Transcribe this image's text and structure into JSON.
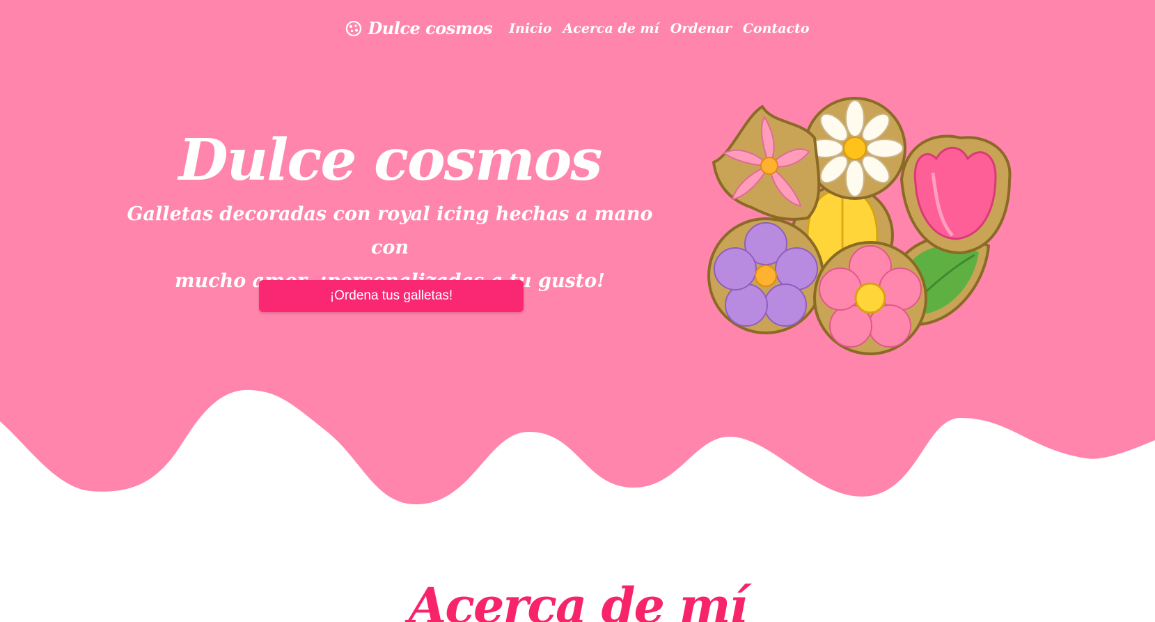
{
  "nav": {
    "brand": "Dulce cosmos",
    "links": [
      "Inicio",
      "Acerca de mí",
      "Ordenar",
      "Contacto"
    ]
  },
  "hero": {
    "title": "Dulce cosmos",
    "subtitle_line1": "Galletas decoradas con royal icing hechas a mano con",
    "subtitle_line2": "mucho amor, ¡personalizadas a tu gusto!",
    "cta": "¡Ordena tus galletas!"
  },
  "about": {
    "title": "Acerca de mí"
  },
  "colors": {
    "hero_bg": "#ff85ac",
    "accent": "#fa2872",
    "about_title": "#f7246a",
    "page_bg": "#ffffff"
  },
  "icons": {
    "brand": "cookie-icon",
    "illustration": "flower-cookies-illustration"
  }
}
